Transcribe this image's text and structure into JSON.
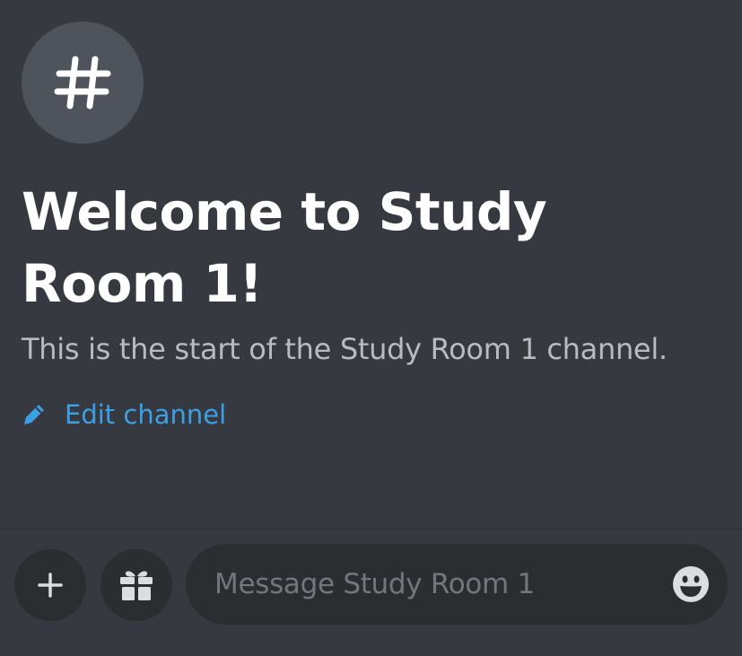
{
  "channel": {
    "avatar_glyph": "#",
    "welcome_title": "Welcome to Study Room 1!",
    "welcome_subtitle": "This is the start of the Study Room 1 channel.",
    "edit_label": "Edit channel"
  },
  "composer": {
    "placeholder": "Message Study Room 1",
    "value": ""
  },
  "icons": {
    "avatar": "hash-icon",
    "edit": "pencil-icon",
    "add": "plus-icon",
    "gift": "gift-icon",
    "emoji": "smiley-icon"
  },
  "colors": {
    "background": "#36393f",
    "avatar_bg": "#4f545c",
    "button_bg": "#2b2d31",
    "link": "#3ba0e6",
    "subtitle": "#b9bbbe",
    "placeholder": "#72767d",
    "icon": "#dcddde"
  }
}
